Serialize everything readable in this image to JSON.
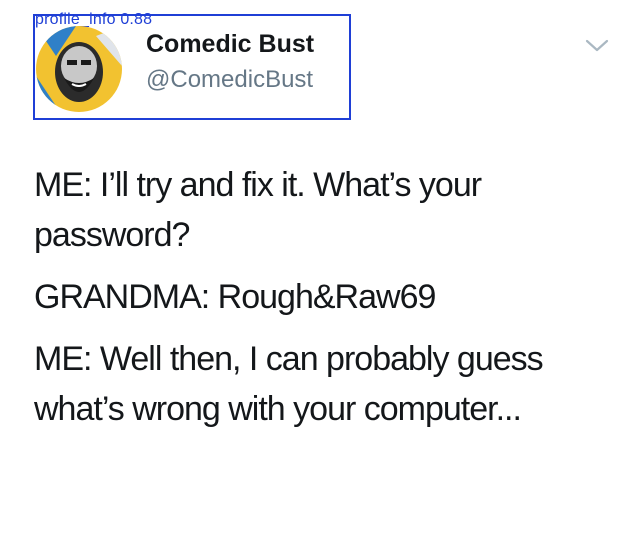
{
  "detection": {
    "label": "profile_info 0.88"
  },
  "author": {
    "display_name": "Comedic Bust",
    "handle": "@ComedicBust",
    "avatar_icon": "avatar-illustration-icon"
  },
  "tweet": {
    "lines": [
      "ME: I’ll try and fix it. What’s your password?",
      "GRANDMA: Rough&Raw69",
      "ME: Well then, I can probably guess what’s wrong with your computer..."
    ]
  },
  "colors": {
    "detect_box": "#1f3fd6",
    "handle": "#657786",
    "text": "#14171a"
  }
}
